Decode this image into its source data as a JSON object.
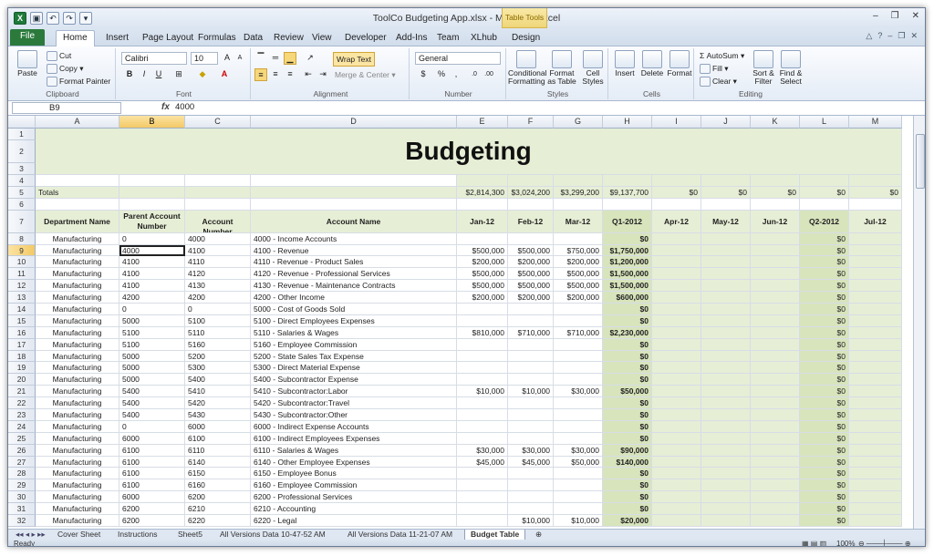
{
  "titlebar": {
    "title": "ToolCo Budgeting App.xlsx - Microsoft Excel",
    "context_tab_group": "Table Tools",
    "window_buttons": [
      "–",
      "❐",
      "✕"
    ]
  },
  "ribbon_tabs": [
    "File",
    "Home",
    "Insert",
    "Page Layout",
    "Formulas",
    "Data",
    "Review",
    "View",
    "Developer",
    "Add-Ins",
    "Team",
    "XLhub",
    "Design"
  ],
  "clipboard": {
    "paste": "Paste",
    "cut": "Cut",
    "copy": "Copy",
    "format_painter": "Format Painter",
    "label": "Clipboard"
  },
  "font": {
    "name": "Calibri",
    "size": "10",
    "bold": "B",
    "italic": "I",
    "underline": "U",
    "grow": "A",
    "shrink": "A",
    "label": "Font"
  },
  "alignment": {
    "wrap_text": "Wrap Text",
    "merge_center": "Merge & Center",
    "label": "Alignment"
  },
  "number": {
    "format": "General",
    "currency": "$",
    "percent": "%",
    "comma": ",",
    "label": "Number"
  },
  "styles": {
    "conditional": "Conditional Formatting",
    "format_table": "Format as Table",
    "cell_styles": "Cell Styles",
    "label": "Styles"
  },
  "cells": {
    "insert": "Insert",
    "delete": "Delete",
    "format": "Format",
    "label": "Cells"
  },
  "editing": {
    "autosum": "AutoSum",
    "fill": "Fill",
    "clear": "Clear",
    "sort_filter": "Sort & Filter",
    "find_select": "Find & Select",
    "label": "Editing"
  },
  "formula_bar": {
    "name_box": "B9",
    "fx": "fx",
    "value": "4000"
  },
  "columns": [
    "A",
    "B",
    "C",
    "D",
    "E",
    "F",
    "G",
    "H",
    "I",
    "J",
    "K",
    "L",
    "M"
  ],
  "sheet": {
    "title": "Budgeting",
    "totals_label": "Totals",
    "totals": [
      "$2,814,300",
      "$3,024,200",
      "$3,299,200",
      "$9,137,700",
      "$0",
      "$0",
      "$0",
      "$0",
      "$0"
    ],
    "headers": [
      "Department Name",
      "Parent Account Number",
      "Account Number",
      "Account Name",
      "Jan-12",
      "Feb-12",
      "Mar-12",
      "Q1-2012",
      "Apr-12",
      "May-12",
      "Jun-12",
      "Q2-2012",
      "Jul-12"
    ],
    "rows": [
      {
        "n": "8",
        "cells": [
          "Manufacturing",
          "0",
          "4000",
          "4000 - Income Accounts",
          "",
          "",
          "",
          "$0",
          "",
          "",
          "",
          "$0",
          ""
        ]
      },
      {
        "n": "9",
        "cells": [
          "Manufacturing",
          "4000",
          "4100",
          "4100 - Revenue",
          "$500,000",
          "$500,000",
          "$750,000",
          "$1,750,000",
          "",
          "",
          "",
          "$0",
          ""
        ]
      },
      {
        "n": "10",
        "cells": [
          "Manufacturing",
          "4100",
          "4110",
          "4110 - Revenue - Product Sales",
          "$200,000",
          "$200,000",
          "$200,000",
          "$1,200,000",
          "",
          "",
          "",
          "$0",
          ""
        ]
      },
      {
        "n": "11",
        "cells": [
          "Manufacturing",
          "4100",
          "4120",
          "4120 - Revenue - Professional Services",
          "$500,000",
          "$500,000",
          "$500,000",
          "$1,500,000",
          "",
          "",
          "",
          "$0",
          ""
        ]
      },
      {
        "n": "12",
        "cells": [
          "Manufacturing",
          "4100",
          "4130",
          "4130 - Revenue - Maintenance Contracts",
          "$500,000",
          "$500,000",
          "$500,000",
          "$1,500,000",
          "",
          "",
          "",
          "$0",
          ""
        ]
      },
      {
        "n": "13",
        "cells": [
          "Manufacturing",
          "4200",
          "4200",
          "4200 - Other Income",
          "$200,000",
          "$200,000",
          "$200,000",
          "$600,000",
          "",
          "",
          "",
          "$0",
          ""
        ]
      },
      {
        "n": "14",
        "cells": [
          "Manufacturing",
          "0",
          "0",
          "5000 - Cost of Goods Sold",
          "",
          "",
          "",
          "$0",
          "",
          "",
          "",
          "$0",
          ""
        ]
      },
      {
        "n": "15",
        "cells": [
          "Manufacturing",
          "5000",
          "5100",
          "5100 - Direct Employees Expenses",
          "",
          "",
          "",
          "$0",
          "",
          "",
          "",
          "$0",
          ""
        ]
      },
      {
        "n": "16",
        "cells": [
          "Manufacturing",
          "5100",
          "5110",
          "5110 - Salaries & Wages",
          "$810,000",
          "$710,000",
          "$710,000",
          "$2,230,000",
          "",
          "",
          "",
          "$0",
          ""
        ]
      },
      {
        "n": "17",
        "cells": [
          "Manufacturing",
          "5100",
          "5160",
          "5160 - Employee Commission",
          "",
          "",
          "",
          "$0",
          "",
          "",
          "",
          "$0",
          ""
        ]
      },
      {
        "n": "18",
        "cells": [
          "Manufacturing",
          "5000",
          "5200",
          "5200 - State Sales Tax Expense",
          "",
          "",
          "",
          "$0",
          "",
          "",
          "",
          "$0",
          ""
        ]
      },
      {
        "n": "19",
        "cells": [
          "Manufacturing",
          "5000",
          "5300",
          "5300 - Direct Material Expense",
          "",
          "",
          "",
          "$0",
          "",
          "",
          "",
          "$0",
          ""
        ]
      },
      {
        "n": "20",
        "cells": [
          "Manufacturing",
          "5000",
          "5400",
          "5400 - Subcontractor Expense",
          "",
          "",
          "",
          "$0",
          "",
          "",
          "",
          "$0",
          ""
        ]
      },
      {
        "n": "21",
        "cells": [
          "Manufacturing",
          "5400",
          "5410",
          "5410 - Subcontractor:Labor",
          "$10,000",
          "$10,000",
          "$30,000",
          "$50,000",
          "",
          "",
          "",
          "$0",
          ""
        ]
      },
      {
        "n": "22",
        "cells": [
          "Manufacturing",
          "5400",
          "5420",
          "5420 - Subcontractor:Travel",
          "",
          "",
          "",
          "$0",
          "",
          "",
          "",
          "$0",
          ""
        ]
      },
      {
        "n": "23",
        "cells": [
          "Manufacturing",
          "5400",
          "5430",
          "5430 - Subcontractor:Other",
          "",
          "",
          "",
          "$0",
          "",
          "",
          "",
          "$0",
          ""
        ]
      },
      {
        "n": "24",
        "cells": [
          "Manufacturing",
          "0",
          "6000",
          "6000 - Indirect Expense Accounts",
          "",
          "",
          "",
          "$0",
          "",
          "",
          "",
          "$0",
          ""
        ]
      },
      {
        "n": "25",
        "cells": [
          "Manufacturing",
          "6000",
          "6100",
          "6100 - Indirect Employees Expenses",
          "",
          "",
          "",
          "$0",
          "",
          "",
          "",
          "$0",
          ""
        ]
      },
      {
        "n": "26",
        "cells": [
          "Manufacturing",
          "6100",
          "6110",
          "6110 - Salaries & Wages",
          "$30,000",
          "$30,000",
          "$30,000",
          "$90,000",
          "",
          "",
          "",
          "$0",
          ""
        ]
      },
      {
        "n": "27",
        "cells": [
          "Manufacturing",
          "6100",
          "6140",
          "6140 - Other Employee Expenses",
          "$45,000",
          "$45,000",
          "$50,000",
          "$140,000",
          "",
          "",
          "",
          "$0",
          ""
        ]
      },
      {
        "n": "28",
        "cells": [
          "Manufacturing",
          "6100",
          "6150",
          "6150 - Employee Bonus",
          "",
          "",
          "",
          "$0",
          "",
          "",
          "",
          "$0",
          ""
        ]
      },
      {
        "n": "29",
        "cells": [
          "Manufacturing",
          "6100",
          "6160",
          "6160 - Employee Commission",
          "",
          "",
          "",
          "$0",
          "",
          "",
          "",
          "$0",
          ""
        ]
      },
      {
        "n": "30",
        "cells": [
          "Manufacturing",
          "6000",
          "6200",
          "6200 - Professional Services",
          "",
          "",
          "",
          "$0",
          "",
          "",
          "",
          "$0",
          ""
        ]
      },
      {
        "n": "31",
        "cells": [
          "Manufacturing",
          "6200",
          "6210",
          "6210 - Accounting",
          "",
          "",
          "",
          "$0",
          "",
          "",
          "",
          "$0",
          ""
        ]
      },
      {
        "n": "32",
        "cells": [
          "Manufacturing",
          "6200",
          "6220",
          "6220 - Legal",
          "",
          "$10,000",
          "$10,000",
          "$20,000",
          "",
          "",
          "",
          "$0",
          ""
        ]
      }
    ]
  },
  "sheet_tabs": [
    "Cover Sheet",
    "Instructions",
    "Sheet5",
    "All Versions Data 10-47-52 AM",
    "All Versions Data 11-21-07 AM",
    "Budget Table"
  ],
  "status": {
    "ready": "Ready",
    "zoom": "100%"
  }
}
